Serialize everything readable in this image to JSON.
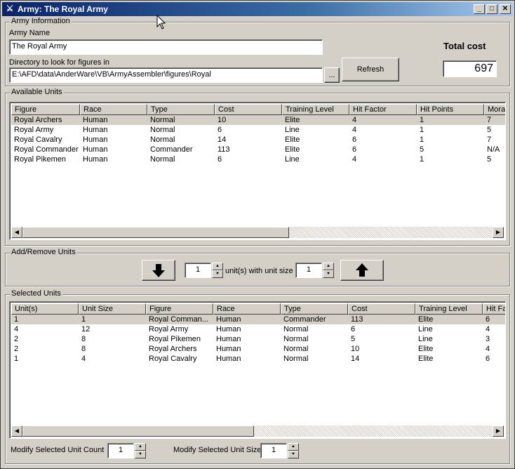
{
  "window": {
    "title": "Army: The Royal Army",
    "icon": "crossed-swords-icon",
    "controls": {
      "minimize": "_",
      "maximize": "□",
      "close": "✕"
    }
  },
  "army_info": {
    "group_label": "Army Information",
    "name_label": "Army Name",
    "name_value": "The Royal Army",
    "dir_label": "Directory to look for figures in",
    "dir_value": "E:\\AFD\\data\\AnderWare\\VB\\ArmyAssembler\\figures\\Royal",
    "browse_label": "...",
    "refresh_label": "Refresh",
    "total_cost_label": "Total cost",
    "total_cost_value": "697"
  },
  "available_units": {
    "group_label": "Available Units",
    "columns": [
      "Figure",
      "Race",
      "Type",
      "Cost",
      "Training Level",
      "Hit Factor",
      "Hit Points",
      "Mora"
    ],
    "rows": [
      [
        "Royal Archers",
        "Human",
        "Normal",
        "10",
        "Elite",
        "4",
        "1",
        "7"
      ],
      [
        "Royal Army",
        "Human",
        "Normal",
        "6",
        "Line",
        "4",
        "1",
        "5"
      ],
      [
        "Royal Cavalry",
        "Human",
        "Normal",
        "14",
        "Elite",
        "6",
        "1",
        "7"
      ],
      [
        "Royal Commander",
        "Human",
        "Commander",
        "113",
        "Elite",
        "6",
        "5",
        "N/A"
      ],
      [
        "Royal Pikemen",
        "Human",
        "Normal",
        "6",
        "Line",
        "4",
        "1",
        "5"
      ]
    ]
  },
  "add_remove": {
    "group_label": "Add/Remove Units",
    "count_value": "1",
    "mid_label": "unit(s) with unit size",
    "size_value": "1",
    "add_icon": "arrow-down-icon",
    "remove_icon": "arrow-up-icon"
  },
  "selected_units": {
    "group_label": "Selected Units",
    "columns": [
      "Unit(s)",
      "Unit Size",
      "Figure",
      "Race",
      "Type",
      "Cost",
      "Training Level",
      "Hit Fa"
    ],
    "rows": [
      [
        "1",
        "1",
        "Royal Comman...",
        "Human",
        "Commander",
        "113",
        "Elite",
        "6"
      ],
      [
        "4",
        "12",
        "Royal Army",
        "Human",
        "Normal",
        "6",
        "Line",
        "4"
      ],
      [
        "2",
        "8",
        "Royal Pikemen",
        "Human",
        "Normal",
        "5",
        "Line",
        "3"
      ],
      [
        "2",
        "8",
        "Royal Archers",
        "Human",
        "Normal",
        "10",
        "Elite",
        "4"
      ],
      [
        "1",
        "4",
        "Royal Cavalry",
        "Human",
        "Normal",
        "14",
        "Elite",
        "6"
      ]
    ],
    "modify_count_label": "Modify Selected Unit Count",
    "modify_count_value": "1",
    "modify_size_label": "Modify Selected Unit Size",
    "modify_size_value": "1"
  },
  "scroll": {
    "left_arrow": "◀",
    "right_arrow": "▶",
    "up_arrow": "▲",
    "down_arrow": "▼"
  }
}
